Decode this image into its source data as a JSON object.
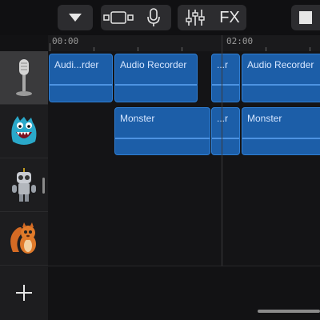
{
  "toolbar": {
    "dropdown_icon": "triangle-down-icon",
    "track_view_icon": "track-view-icon",
    "mic_icon": "microphone-icon",
    "mixer_icon": "mixer-sliders-icon",
    "fx_label": "FX",
    "stop_icon": "stop-icon"
  },
  "ruler": {
    "labels": [
      "00:00",
      "02:00"
    ]
  },
  "tracks": [
    {
      "name": "Audio Recorder",
      "icon": "microphone-icon",
      "selected": true
    },
    {
      "name": "Monster",
      "icon": "monster-icon",
      "selected": false
    },
    {
      "name": "Robot",
      "icon": "robot-icon",
      "selected": false
    },
    {
      "name": "Squirrel",
      "icon": "squirrel-icon",
      "selected": false
    }
  ],
  "regions": {
    "track1": [
      "Audi...rder",
      "Audio Recorder",
      "...r",
      "Audio Recorder"
    ],
    "track2": [
      "Monster",
      "...r",
      "Monster"
    ]
  },
  "add_track_icon": "plus-icon",
  "colors": {
    "region_fill": "#1c5ea8",
    "region_border": "#2f7ed3",
    "background": "#121214"
  }
}
